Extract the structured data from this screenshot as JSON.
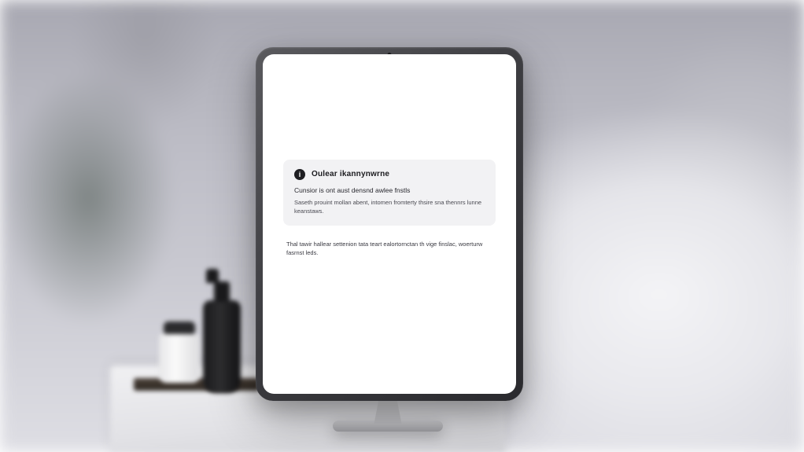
{
  "card": {
    "icon_label": "i",
    "title": "Oulear ikannynwrne",
    "subtitle": "Cunsior is ont aust densnd awlee fnstls",
    "body": "Saseth prouint mollan abent, intomen fromterty thsire sna thennrs lunne keanstaws."
  },
  "footnote": "Thal tawir hallear settenion tata teart ealortornctan th vige finslac, woerturw fasrnst leds."
}
